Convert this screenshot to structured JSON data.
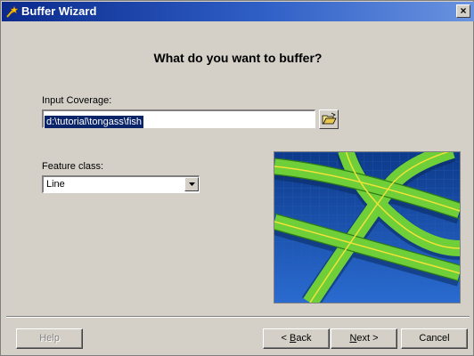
{
  "window": {
    "title": "Buffer Wizard",
    "close_glyph": "×"
  },
  "page": {
    "heading": "What do you want to buffer?"
  },
  "input_coverage": {
    "label": "Input Coverage:",
    "value": "d:\\tutorial\\tongass\\fish",
    "browse_icon": "open-folder-icon"
  },
  "feature_class": {
    "label": "Feature class:",
    "selected": "Line"
  },
  "buttons": {
    "help": "Help",
    "back_mnemonic": "B",
    "back_rest": "ack",
    "back_prefix": "< ",
    "next_mnemonic": "N",
    "next_rest": "ext >",
    "cancel": "Cancel"
  },
  "colors": {
    "titlebar_start": "#0b2a8c",
    "titlebar_end": "#6a93e0",
    "dialog_bg": "#d4d0c8",
    "selection_bg": "#0a246a",
    "preview_water": "#1e4fa8",
    "preview_line": "#7fd63a"
  }
}
